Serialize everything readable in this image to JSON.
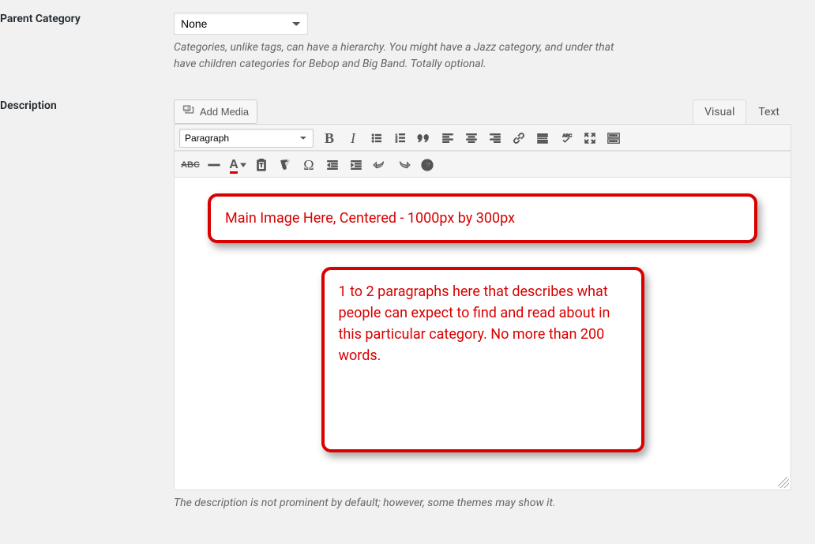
{
  "fields": {
    "parent_category": {
      "label": "Parent Category",
      "selected": "None",
      "help": "Categories, unlike tags, can have a hierarchy. You might have a Jazz category, and under that have children categories for Bebop and Big Band. Totally optional."
    },
    "description": {
      "label": "Description",
      "add_media_label": "Add Media",
      "tabs": {
        "visual": "Visual",
        "text": "Text",
        "active": "visual"
      },
      "block_format": "Paragraph",
      "content": {
        "box1": "Main Image Here, Centered - 1000px by 300px",
        "box2": "1 to 2 paragraphs here that describes what people can expect to find and read about in this particular category. No more than 200 words."
      },
      "help": "The description is not prominent by default; however, some themes may show it."
    }
  },
  "toolbar_icons_row1": [
    "bold",
    "italic",
    "bullet-list",
    "numbered-list",
    "blockquote",
    "align-left",
    "align-center",
    "align-right",
    "link",
    "read-more",
    "spellcheck",
    "fullscreen",
    "toolbar-toggle"
  ],
  "toolbar_icons_row2": [
    "strikethrough",
    "horizontal-rule",
    "text-color",
    "paste-text",
    "clear-format",
    "special-char",
    "outdent",
    "indent",
    "undo",
    "redo",
    "help"
  ]
}
